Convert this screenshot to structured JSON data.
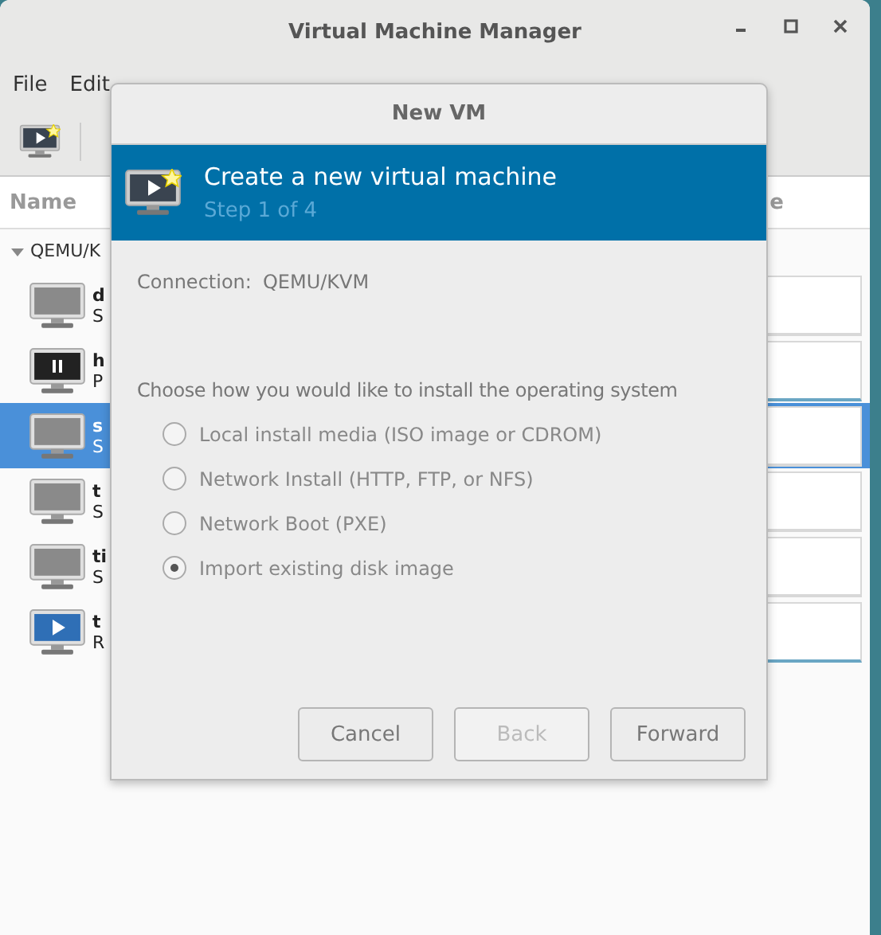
{
  "window": {
    "title": "Virtual Machine Manager"
  },
  "menu": [
    "File",
    "Edit"
  ],
  "list": {
    "columns": [
      "Name",
      "e"
    ],
    "group": {
      "label": "QEMU/K",
      "expanded": true
    },
    "rows": [
      {
        "name": "d",
        "status": "S",
        "kind": "off",
        "selected": false
      },
      {
        "name": "h",
        "status": "P",
        "kind": "paused",
        "selected": false
      },
      {
        "name": "s",
        "status": "S",
        "kind": "off",
        "selected": true
      },
      {
        "name": "t",
        "status": "S",
        "kind": "off",
        "selected": false
      },
      {
        "name": "ti",
        "status": "S",
        "kind": "off",
        "selected": false
      },
      {
        "name": "t",
        "status": "R",
        "kind": "running",
        "selected": false
      }
    ]
  },
  "dialog": {
    "title": "New VM",
    "header": {
      "title": "Create a new virtual machine",
      "step": "Step 1 of 4"
    },
    "connection": {
      "label": "Connection:",
      "value": "QEMU/KVM"
    },
    "prompt": "Choose how you would like to install the operating system",
    "options": [
      {
        "label": "Local install media (ISO image or CDROM)",
        "selected": false
      },
      {
        "label": "Network Install (HTTP, FTP, or NFS)",
        "selected": false
      },
      {
        "label": "Network Boot (PXE)",
        "selected": false
      },
      {
        "label": "Import existing disk image",
        "selected": true
      }
    ],
    "buttons": [
      {
        "label": "Cancel",
        "disabled": false
      },
      {
        "label": "Back",
        "disabled": true
      },
      {
        "label": "Forward",
        "disabled": false
      }
    ]
  }
}
